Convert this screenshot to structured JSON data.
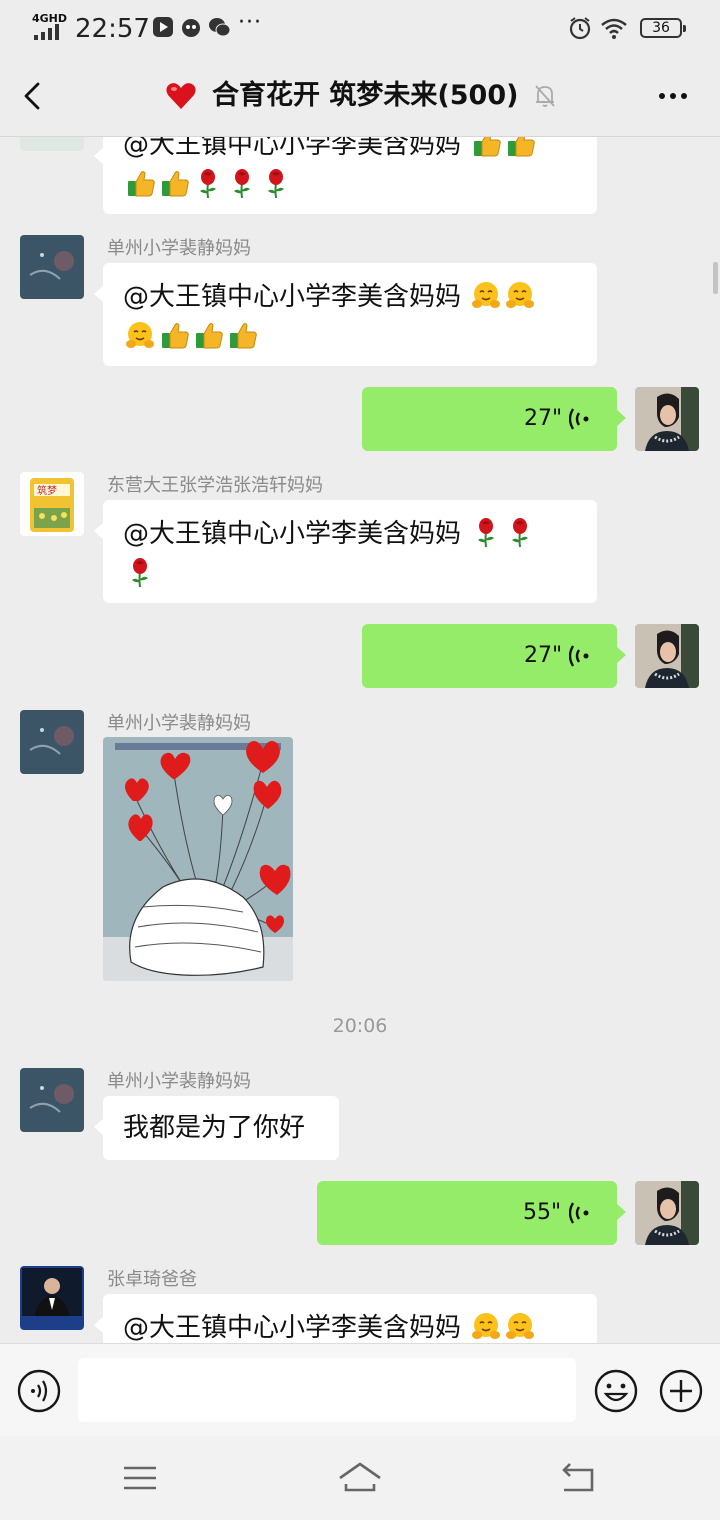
{
  "status_bar": {
    "network": "4GHD",
    "time": "22:57",
    "more": "···",
    "battery": "36"
  },
  "header": {
    "title": "合育花开 筑梦未来(500)"
  },
  "messages": {
    "m0": {
      "text": "@大王镇中心小学李美含妈妈 "
    },
    "m1": {
      "sender": "单州小学裴静妈妈",
      "text": "@大王镇中心小学李美含妈妈 "
    },
    "m2": {
      "duration": "27\""
    },
    "m3": {
      "sender": "东营大王张学浩张浩轩妈妈",
      "text": "@大王镇中心小学李美含妈妈 "
    },
    "m4": {
      "duration": "27\""
    },
    "m5": {
      "sender": "单州小学裴静妈妈"
    },
    "timestamp": "20:06",
    "m6": {
      "sender": "单州小学裴静妈妈",
      "text": "我都是为了你好"
    },
    "m7": {
      "duration": "55\""
    },
    "m8": {
      "sender": "张卓琦爸爸",
      "text": "@大王镇中心小学李美含妈妈 "
    }
  },
  "input": {
    "value": "",
    "placeholder": ""
  },
  "colors": {
    "outgoing_bubble": "#95ec69",
    "incoming_bubble": "#ffffff",
    "background": "#ededed"
  },
  "icons": [
    "back-icon",
    "heart-icon",
    "mute-bell-icon",
    "more-icon",
    "voice-icon",
    "emoji-icon",
    "plus-icon",
    "menu-icon",
    "home-icon",
    "return-icon"
  ]
}
